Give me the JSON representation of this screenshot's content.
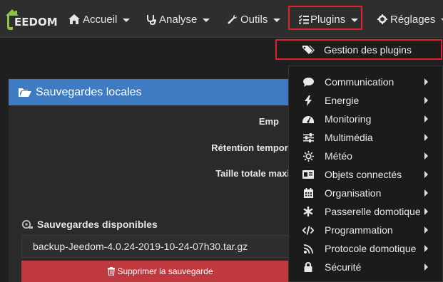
{
  "logo": {
    "text": "EEDOM"
  },
  "nav": [
    {
      "label": "Accueil",
      "icon": "home-icon"
    },
    {
      "label": "Analyse",
      "icon": "stethoscope-icon"
    },
    {
      "label": "Outils",
      "icon": "wrench-icon"
    },
    {
      "label": "Plugins",
      "icon": "tasks-icon"
    },
    {
      "label": "Réglages",
      "icon": "cogs-icon"
    }
  ],
  "highlight_color": "#e0202a",
  "plugins_menu": {
    "manage": {
      "label": "Gestion des plugins",
      "icon": "tags-icon"
    },
    "categories": [
      {
        "label": "Communication",
        "icon": "comment-icon"
      },
      {
        "label": "Energie",
        "icon": "bolt-icon"
      },
      {
        "label": "Monitoring",
        "icon": "tachometer-icon"
      },
      {
        "label": "Multimédia",
        "icon": "sliders-icon"
      },
      {
        "label": "Météo",
        "icon": "sun-icon"
      },
      {
        "label": "Objets connectés",
        "icon": "id-card-icon"
      },
      {
        "label": "Organisation",
        "icon": "calendar-icon"
      },
      {
        "label": "Passerelle domotique",
        "icon": "asterisk-icon"
      },
      {
        "label": "Programmation",
        "icon": "code-icon"
      },
      {
        "label": "Protocole domotique",
        "icon": "rss-icon"
      },
      {
        "label": "Sécurité",
        "icon": "lock-icon"
      }
    ]
  },
  "panel": {
    "title": "Sauvegardes locales",
    "title_color": "#3e7bc2",
    "fields": [
      {
        "label": "Emp"
      },
      {
        "label": "Rétention tempore"
      },
      {
        "label": "Taille totale maxi"
      }
    ],
    "available_title": "Sauvegardes disponibles",
    "selected_backup": "backup-Jeedom-4.0.24-2019-10-24-07h30.tar.gz",
    "delete_label": "Supprimer la sauvegarde",
    "delete_color": "#c0393f"
  }
}
